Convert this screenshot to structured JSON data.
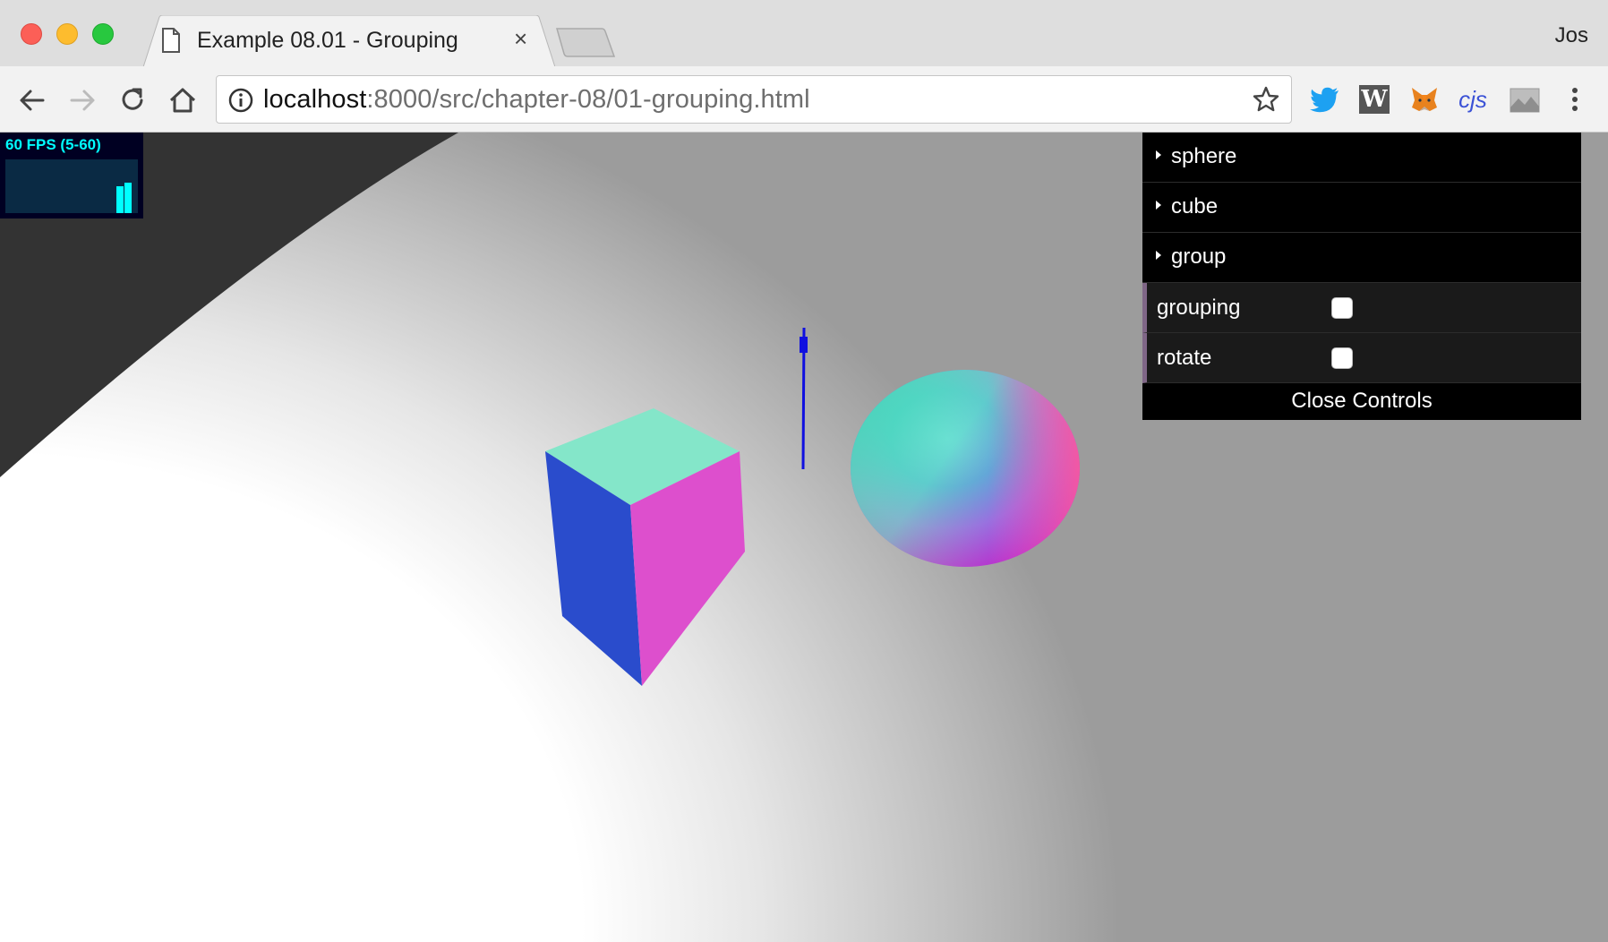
{
  "window": {
    "tab_title": "Example 08.01 - Grouping",
    "tab_close": "×",
    "profile_name": "Jos"
  },
  "toolbar": {
    "url_host": "localhost",
    "url_rest": ":8000/src/chapter-08/01-grouping.html",
    "extensions": [
      "twitter-icon",
      "w-extension-icon",
      "metamask-fox-icon",
      "cjs-extension-icon",
      "image-extension-icon"
    ],
    "ext_w_label": "W",
    "ext_cjs_label": "cjs"
  },
  "stats": {
    "fps_text": "60 FPS (5-60)"
  },
  "gui": {
    "folders": [
      {
        "label": "sphere"
      },
      {
        "label": "cube"
      },
      {
        "label": "group"
      }
    ],
    "controls": [
      {
        "label": "grouping",
        "checked": false
      },
      {
        "label": "rotate",
        "checked": false
      }
    ],
    "close_label": "Close Controls",
    "accent_color": "#806787"
  },
  "scene": {
    "objects": [
      "cube",
      "sphere",
      "axis-line"
    ],
    "cube_colors": {
      "top": "#84e6c9",
      "left": "#2a4ccc",
      "right": "#dd4fcd"
    },
    "axis_color": "#1010e0"
  }
}
